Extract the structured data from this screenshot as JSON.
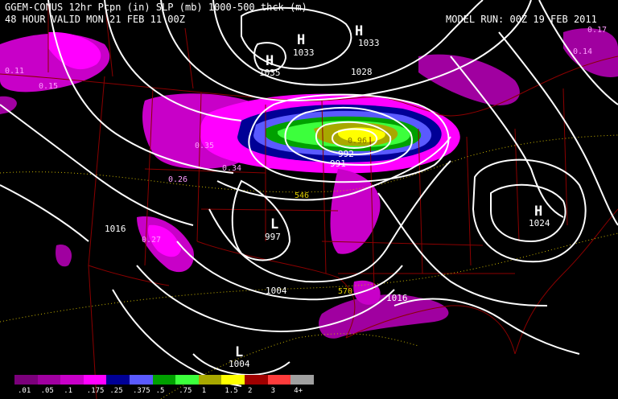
{
  "header": {
    "line1": "GGEM-CONUS 12hr Pcpn (in) SLP (mb) 1000-500 thck (m)",
    "line2": "48 HOUR VALID MON 21 FEB 11 00Z",
    "model_run": "MODEL RUN: 00Z 19 FEB 2011"
  },
  "colors": {
    "background": "#000000",
    "isobar": "#ffffff",
    "borders": "#8b0000",
    "thickness": "#c8b400"
  },
  "pressure_centers": [
    {
      "type": "H",
      "value": "1033"
    },
    {
      "type": "H",
      "value": "1033"
    },
    {
      "type": "H",
      "value": "1035"
    },
    {
      "type": "H",
      "value": "1024"
    },
    {
      "type": "L",
      "value": "997"
    },
    {
      "type": "L",
      "value": "1004"
    }
  ],
  "isobar_labels": [
    "1028",
    "1016",
    "1004",
    "1016",
    "992",
    "991"
  ],
  "precip_labels": [
    "0.11",
    "0.15",
    "0.35",
    "0.34",
    "0.26",
    "0.27",
    "0.14",
    "0.17",
    "0.96"
  ],
  "thickness_labels": [
    "546",
    "570"
  ],
  "legend": {
    "labels": [
      ".01",
      ".05",
      ".1",
      ".175",
      ".25",
      ".375",
      ".5",
      ".75",
      "1",
      "1.5",
      "2",
      "3",
      "4+"
    ],
    "colors": [
      "#7b007b",
      "#a000a0",
      "#c800c8",
      "#ff00ff",
      "#000096",
      "#5a5aff",
      "#00a000",
      "#3cff3c",
      "#a8a800",
      "#ffff00",
      "#a00000",
      "#ff3c3c",
      "#a0a0a0"
    ]
  }
}
